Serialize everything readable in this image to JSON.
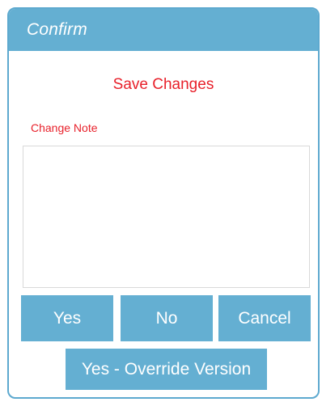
{
  "dialog": {
    "title": "Confirm",
    "heading": "Save Changes",
    "note_label": "Change Note",
    "note_value": "",
    "buttons": {
      "yes": "Yes",
      "no": "No",
      "cancel": "Cancel",
      "override": "Yes - Override Version"
    }
  },
  "colors": {
    "accent": "#64afd2",
    "heading_text": "#e8212b",
    "border": "#5da9cf"
  }
}
